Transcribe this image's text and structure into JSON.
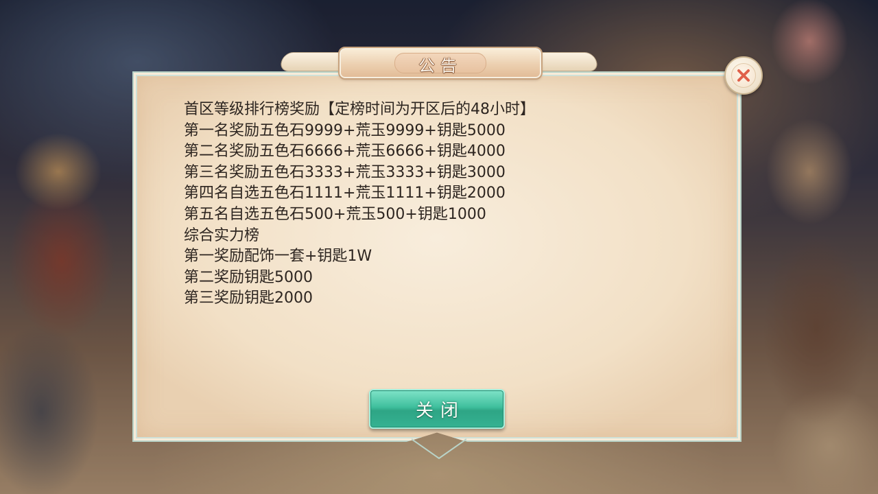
{
  "dialog": {
    "title": "公告",
    "close_button_label": "关闭",
    "close_icon": "close-x-icon",
    "lines": [
      "首区等级排行榜奖励【定榜时间为开区后的48小时】",
      "第一名奖励五色石9999+荒玉9999+钥匙5000",
      "第二名奖励五色石6666+荒玉6666+钥匙4000",
      "第三名奖励五色石3333+荒玉3333+钥匙3000",
      "第四名自选五色石1111+荒玉1111+钥匙2000",
      "第五名自选五色石500+荒玉500+钥匙1000",
      "综合实力榜",
      "第一奖励配饰一套+钥匙1W",
      "第二奖励钥匙5000",
      "第三奖励钥匙2000"
    ]
  },
  "colors": {
    "panel": "#f2e0c6",
    "button": "#3fbf9d",
    "close_x": "#e0604a",
    "text": "#2d2520"
  }
}
